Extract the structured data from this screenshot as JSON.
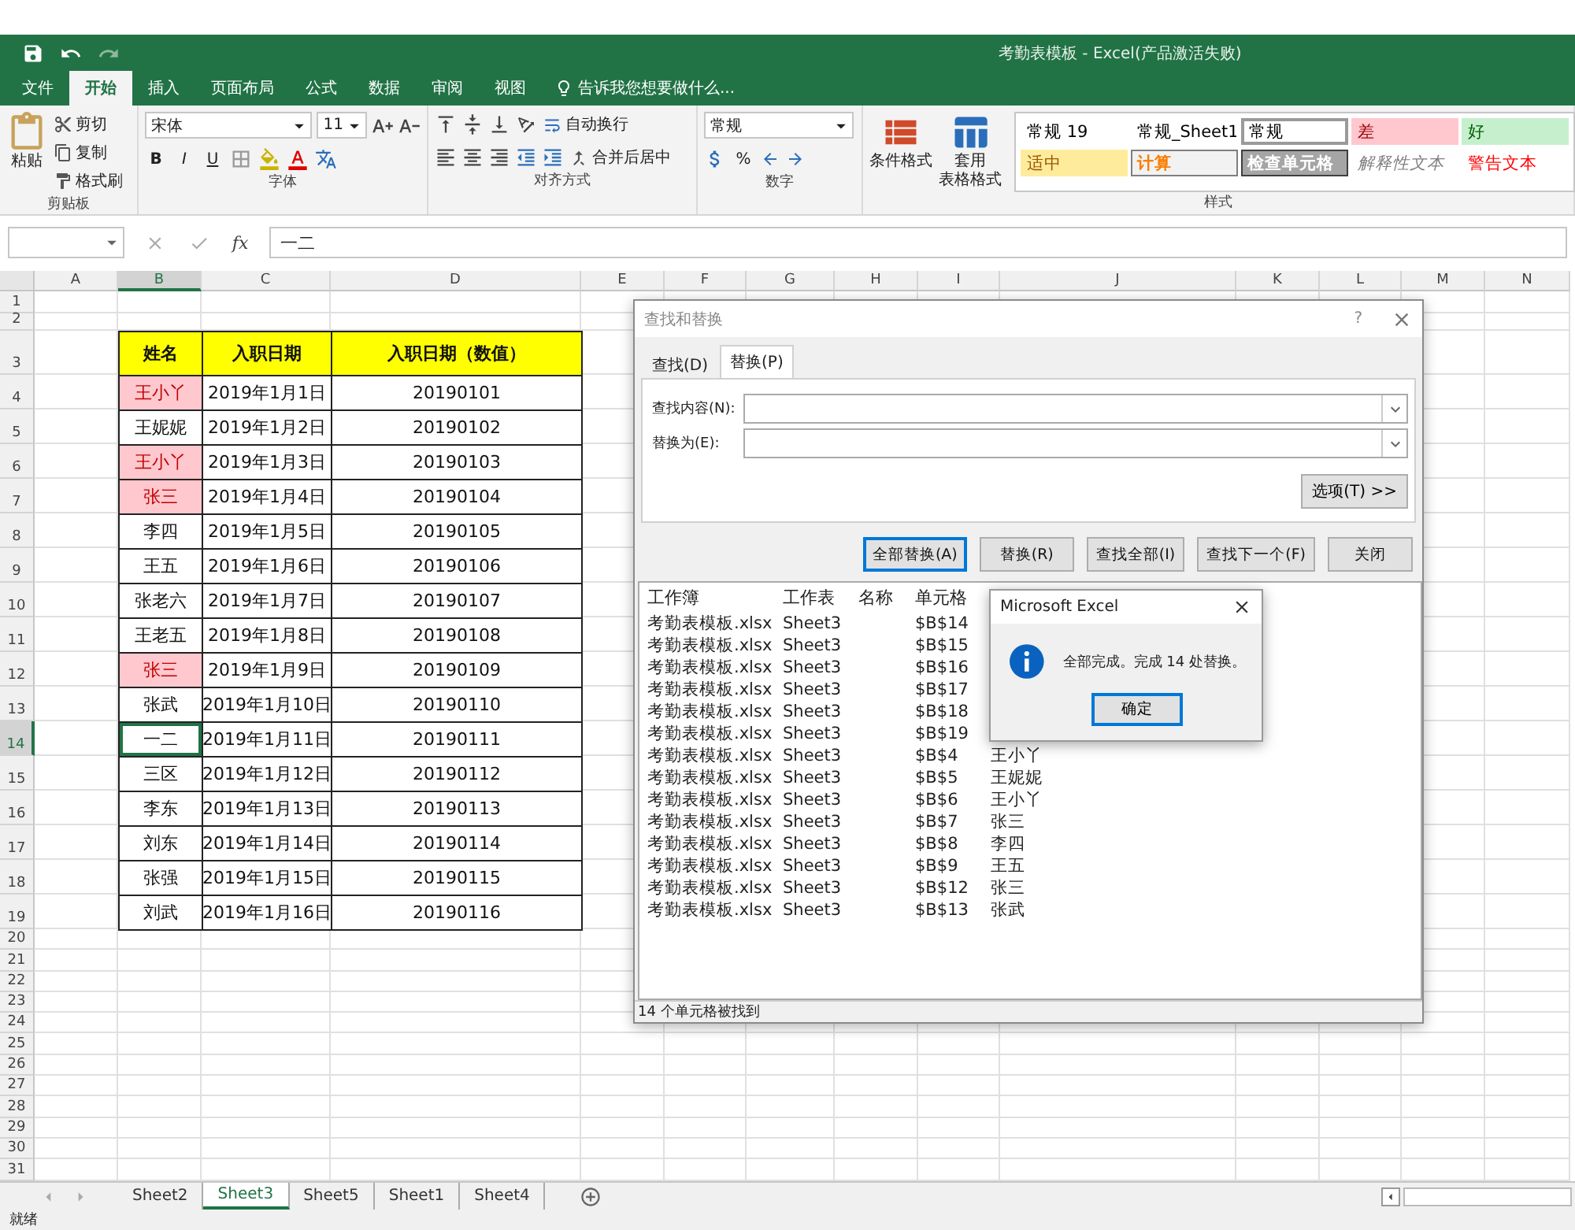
{
  "title_bar": {
    "title": "考勤表模板 - Excel(产品激活失败)"
  },
  "ribbon_tabs": [
    {
      "label": "文件",
      "selected": false
    },
    {
      "label": "开始",
      "selected": true
    },
    {
      "label": "插入",
      "selected": false
    },
    {
      "label": "页面布局",
      "selected": false
    },
    {
      "label": "公式",
      "selected": false
    },
    {
      "label": "数据",
      "selected": false
    },
    {
      "label": "审阅",
      "selected": false
    },
    {
      "label": "视图",
      "selected": false
    }
  ],
  "tell_me": "告诉我您想要做什么...",
  "ribbon": {
    "clipboard": {
      "paste": "粘贴",
      "items": [
        "剪切",
        "复制",
        "格式刷"
      ],
      "label": "剪贴板"
    },
    "font": {
      "name": "宋体",
      "size": "11",
      "bold": "B",
      "italic": "I",
      "underline": "U",
      "label": "字体"
    },
    "alignment": {
      "wrap": "自动换行",
      "merge": "合并后居中",
      "label": "对齐方式"
    },
    "number": {
      "format": "常规",
      "percent": "%",
      "label": "数字"
    },
    "styles": {
      "conditional": "条件格式",
      "table_lines": [
        "套用",
        "表格格式"
      ],
      "label": "样式",
      "cells": [
        {
          "label": "常规 19",
          "kind": "normal",
          "selected": false
        },
        {
          "label": "常规_Sheet1",
          "kind": "normal",
          "selected": false
        },
        {
          "label": "常规",
          "kind": "normal",
          "selected": true
        },
        {
          "label": "差",
          "kind": "bad",
          "selected": false
        },
        {
          "label": "好",
          "kind": "good",
          "selected": false
        },
        {
          "label": "适中",
          "kind": "neutral",
          "selected": false
        },
        {
          "label": "计算",
          "kind": "calculation",
          "selected": false
        },
        {
          "label": "检查单元格",
          "kind": "check",
          "selected": false
        },
        {
          "label": "解释性文本",
          "kind": "explanatory",
          "selected": false
        },
        {
          "label": "警告文本",
          "kind": "warning",
          "selected": false
        }
      ]
    }
  },
  "formula_bar": {
    "function_label": "fx",
    "value": "一二"
  },
  "columns": [
    {
      "label": "A",
      "selected": false
    },
    {
      "label": "B",
      "selected": true
    },
    {
      "label": "C",
      "selected": false
    },
    {
      "label": "D",
      "selected": false
    },
    {
      "label": "E",
      "selected": false
    },
    {
      "label": "F",
      "selected": false
    },
    {
      "label": "G",
      "selected": false
    },
    {
      "label": "H",
      "selected": false
    },
    {
      "label": "I",
      "selected": false
    },
    {
      "label": "J",
      "selected": false
    },
    {
      "label": "K",
      "selected": false
    },
    {
      "label": "L",
      "selected": false
    },
    {
      "label": "M",
      "selected": false
    },
    {
      "label": "N",
      "selected": false
    }
  ],
  "row_numbers": [
    {
      "label": "1",
      "selected": false
    },
    {
      "label": "2",
      "selected": false
    },
    {
      "label": "3",
      "selected": false
    },
    {
      "label": "4",
      "selected": false
    },
    {
      "label": "5",
      "selected": false
    },
    {
      "label": "6",
      "selected": false
    },
    {
      "label": "7",
      "selected": false
    },
    {
      "label": "8",
      "selected": false
    },
    {
      "label": "9",
      "selected": false
    },
    {
      "label": "10",
      "selected": false
    },
    {
      "label": "11",
      "selected": false
    },
    {
      "label": "12",
      "selected": false
    },
    {
      "label": "13",
      "selected": false
    },
    {
      "label": "14",
      "selected": true
    },
    {
      "label": "15",
      "selected": false
    },
    {
      "label": "16",
      "selected": false
    },
    {
      "label": "17",
      "selected": false
    },
    {
      "label": "18",
      "selected": false
    },
    {
      "label": "19",
      "selected": false
    },
    {
      "label": "20",
      "selected": false
    },
    {
      "label": "21",
      "selected": false
    },
    {
      "label": "22",
      "selected": false
    },
    {
      "label": "23",
      "selected": false
    },
    {
      "label": "24",
      "selected": false
    },
    {
      "label": "25",
      "selected": false
    },
    {
      "label": "26",
      "selected": false
    },
    {
      "label": "27",
      "selected": false
    },
    {
      "label": "28",
      "selected": false
    },
    {
      "label": "29",
      "selected": false
    },
    {
      "label": "30",
      "selected": false
    },
    {
      "label": "31",
      "selected": false
    }
  ],
  "table": {
    "headers": [
      "姓名",
      "入职日期",
      "入职日期（数值）"
    ],
    "rows": [
      {
        "name": "王小丫",
        "date": "2019年1月1日",
        "value": "20190101",
        "highlighted": true,
        "selected": false
      },
      {
        "name": "王妮妮",
        "date": "2019年1月2日",
        "value": "20190102",
        "highlighted": false,
        "selected": false
      },
      {
        "name": "王小丫",
        "date": "2019年1月3日",
        "value": "20190103",
        "highlighted": true,
        "selected": false
      },
      {
        "name": "张三",
        "date": "2019年1月4日",
        "value": "20190104",
        "highlighted": true,
        "selected": false
      },
      {
        "name": "李四",
        "date": "2019年1月5日",
        "value": "20190105",
        "highlighted": false,
        "selected": false
      },
      {
        "name": "王五",
        "date": "2019年1月6日",
        "value": "20190106",
        "highlighted": false,
        "selected": false
      },
      {
        "name": "张老六",
        "date": "2019年1月7日",
        "value": "20190107",
        "highlighted": false,
        "selected": false
      },
      {
        "name": "王老五",
        "date": "2019年1月8日",
        "value": "20190108",
        "highlighted": false,
        "selected": false
      },
      {
        "name": "张三",
        "date": "2019年1月9日",
        "value": "20190109",
        "highlighted": true,
        "selected": false
      },
      {
        "name": "张武",
        "date": "2019年1月10日",
        "value": "20190110",
        "highlighted": false,
        "selected": false
      },
      {
        "name": "一二",
        "date": "2019年1月11日",
        "value": "20190111",
        "highlighted": false,
        "selected": true
      },
      {
        "name": "三区",
        "date": "2019年1月12日",
        "value": "20190112",
        "highlighted": false,
        "selected": false
      },
      {
        "name": "李东",
        "date": "2019年1月13日",
        "value": "20190113",
        "highlighted": false,
        "selected": false
      },
      {
        "name": "刘东",
        "date": "2019年1月14日",
        "value": "20190114",
        "highlighted": false,
        "selected": false
      },
      {
        "name": "张强",
        "date": "2019年1月15日",
        "value": "20190115",
        "highlighted": false,
        "selected": false
      },
      {
        "name": "刘武",
        "date": "2019年1月16日",
        "value": "20190116",
        "highlighted": false,
        "selected": false
      }
    ]
  },
  "sheet_tabs": [
    {
      "label": "Sheet2",
      "selected": false
    },
    {
      "label": "Sheet3",
      "selected": true
    },
    {
      "label": "Sheet5",
      "selected": false
    },
    {
      "label": "Sheet1",
      "selected": false
    },
    {
      "label": "Sheet4",
      "selected": false
    }
  ],
  "status_bar": "就绪",
  "find_dialog": {
    "title": "查找和替换",
    "help": "?",
    "tabs": [
      {
        "label": "查找(D)",
        "selected": false
      },
      {
        "label": "替换(P)",
        "selected": true
      }
    ],
    "fields": [
      {
        "label": "查找内容(N):"
      },
      {
        "label": "替换为(E):"
      }
    ],
    "options_button": "选项(T) >>",
    "buttons": [
      {
        "label": "全部替换(A)",
        "default": true
      },
      {
        "label": "替换(R)",
        "default": false
      },
      {
        "label": "查找全部(I)",
        "default": false
      },
      {
        "label": "查找下一个(F)",
        "default": false
      },
      {
        "label": "关闭",
        "default": false
      }
    ],
    "result_columns": [
      "工作簿",
      "工作表",
      "名称",
      "单元格"
    ],
    "results": [
      {
        "book": "考勤表模板.xlsx",
        "sheet": "Sheet3",
        "cell": "$B$14"
      },
      {
        "book": "考勤表模板.xlsx",
        "sheet": "Sheet3",
        "cell": "$B$15"
      },
      {
        "book": "考勤表模板.xlsx",
        "sheet": "Sheet3",
        "cell": "$B$16"
      },
      {
        "book": "考勤表模板.xlsx",
        "sheet": "Sheet3",
        "cell": "$B$17"
      },
      {
        "book": "考勤表模板.xlsx",
        "sheet": "Sheet3",
        "cell": "$B$18"
      },
      {
        "book": "考勤表模板.xlsx",
        "sheet": "Sheet3",
        "cell": "$B$19"
      },
      {
        "book": "考勤表模板.xlsx",
        "sheet": "Sheet3",
        "cell": "$B$4",
        "value": "王小丫"
      },
      {
        "book": "考勤表模板.xlsx",
        "sheet": "Sheet3",
        "cell": "$B$5",
        "value": "王妮妮"
      },
      {
        "book": "考勤表模板.xlsx",
        "sheet": "Sheet3",
        "cell": "$B$6",
        "value": "王小丫"
      },
      {
        "book": "考勤表模板.xlsx",
        "sheet": "Sheet3",
        "cell": "$B$7",
        "value": "张三"
      },
      {
        "book": "考勤表模板.xlsx",
        "sheet": "Sheet3",
        "cell": "$B$8",
        "value": "李四"
      },
      {
        "book": "考勤表模板.xlsx",
        "sheet": "Sheet3",
        "cell": "$B$9",
        "value": "王五"
      },
      {
        "book": "考勤表模板.xlsx",
        "sheet": "Sheet3",
        "cell": "$B$12",
        "value": "张三"
      },
      {
        "book": "考勤表模板.xlsx",
        "sheet": "Sheet3",
        "cell": "$B$13",
        "value": "张武"
      }
    ],
    "status": "14 个单元格被找到"
  },
  "message_box": {
    "title": "Microsoft Excel",
    "message": "全部完成。完成 14 处替换。",
    "button": "确定"
  }
}
